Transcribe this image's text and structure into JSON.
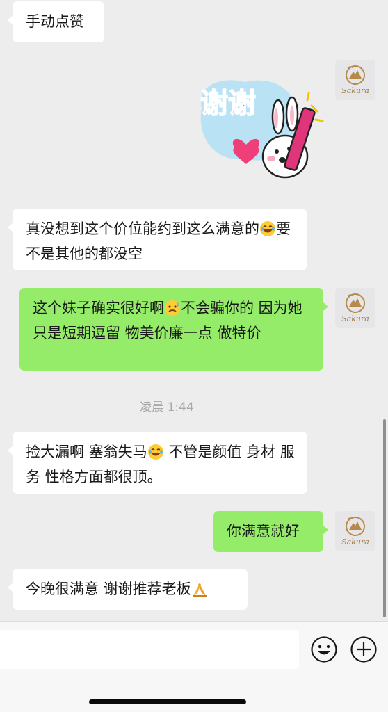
{
  "messages": [
    {
      "direction": "in",
      "text": "手动点赞"
    },
    {
      "direction": "out",
      "type": "sticker",
      "sticker_text": "谢谢"
    },
    {
      "direction": "in",
      "before": "真没想到这个价位能约到这么满意的",
      "emoji": "😂",
      "after": "要不是其他的都没空"
    },
    {
      "direction": "out",
      "before": "这个妹子确实很好啊",
      "emoji": "😥",
      "after": "不会骗你的 因为她只是短期逗留 物美价廉一点 做特价"
    },
    {
      "direction": "in",
      "before": "捡大漏啊 塞翁失马",
      "emoji": "😂",
      "after": " 不管是颜值 身材 服务 性格方面都很顶。"
    },
    {
      "direction": "out",
      "text": "你满意就好"
    },
    {
      "direction": "in",
      "before": "今晚很满意 谢谢推荐老板",
      "emoji": "🙏"
    }
  ],
  "timestamp": "凌晨 1:44",
  "avatar": {
    "brand_text": "Sakura"
  },
  "input_bar": {
    "emoji_button": "emoji-button",
    "plus_button": "plus-button"
  },
  "colors": {
    "background": "#ededed",
    "incoming_bubble": "#ffffff",
    "outgoing_bubble": "#95ec69",
    "timestamp": "#a8a8a8"
  }
}
